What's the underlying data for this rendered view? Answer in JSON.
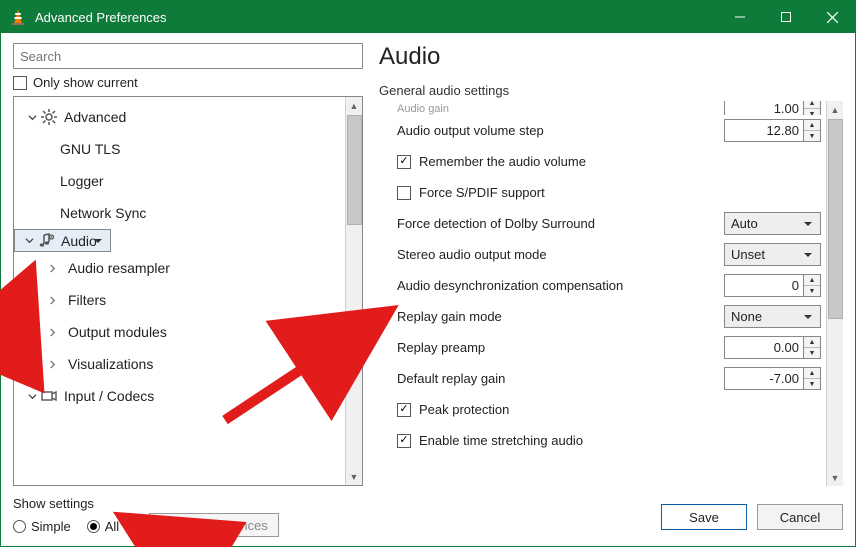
{
  "window": {
    "title": "Advanced Preferences"
  },
  "left": {
    "search_placeholder": "Search",
    "only_show_current": "Only show current",
    "tree": {
      "advanced": "Advanced",
      "gnu_tls": "GNU TLS",
      "logger": "Logger",
      "network_sync": "Network Sync",
      "audio": "Audio",
      "audio_resampler": "Audio resampler",
      "filters": "Filters",
      "output_modules": "Output modules",
      "visualizations": "Visualizations",
      "input_codecs": "Input / Codecs"
    }
  },
  "right": {
    "title": "Audio",
    "section": "General audio settings",
    "rows": {
      "audio_gain_cut": "Audio gain",
      "audio_gain_cut_val": "1.00",
      "vol_step": "Audio output volume step",
      "vol_step_val": "12.80",
      "remember": "Remember the audio volume",
      "spdif": "Force S/PDIF support",
      "dolby": "Force detection of Dolby Surround",
      "dolby_val": "Auto",
      "stereo": "Stereo audio output mode",
      "stereo_val": "Unset",
      "desync": "Audio desynchronization compensation",
      "desync_val": "0",
      "replay_mode": "Replay gain mode",
      "replay_mode_val": "None",
      "preamp": "Replay preamp",
      "preamp_val": "0.00",
      "def_replay": "Default replay gain",
      "def_replay_val": "-7.00",
      "peak": "Peak protection",
      "stretch": "Enable time stretching audio"
    }
  },
  "footer": {
    "show_settings": "Show settings",
    "simple": "Simple",
    "all": "All",
    "reset": "Reset Preferences",
    "save": "Save",
    "cancel": "Cancel"
  }
}
